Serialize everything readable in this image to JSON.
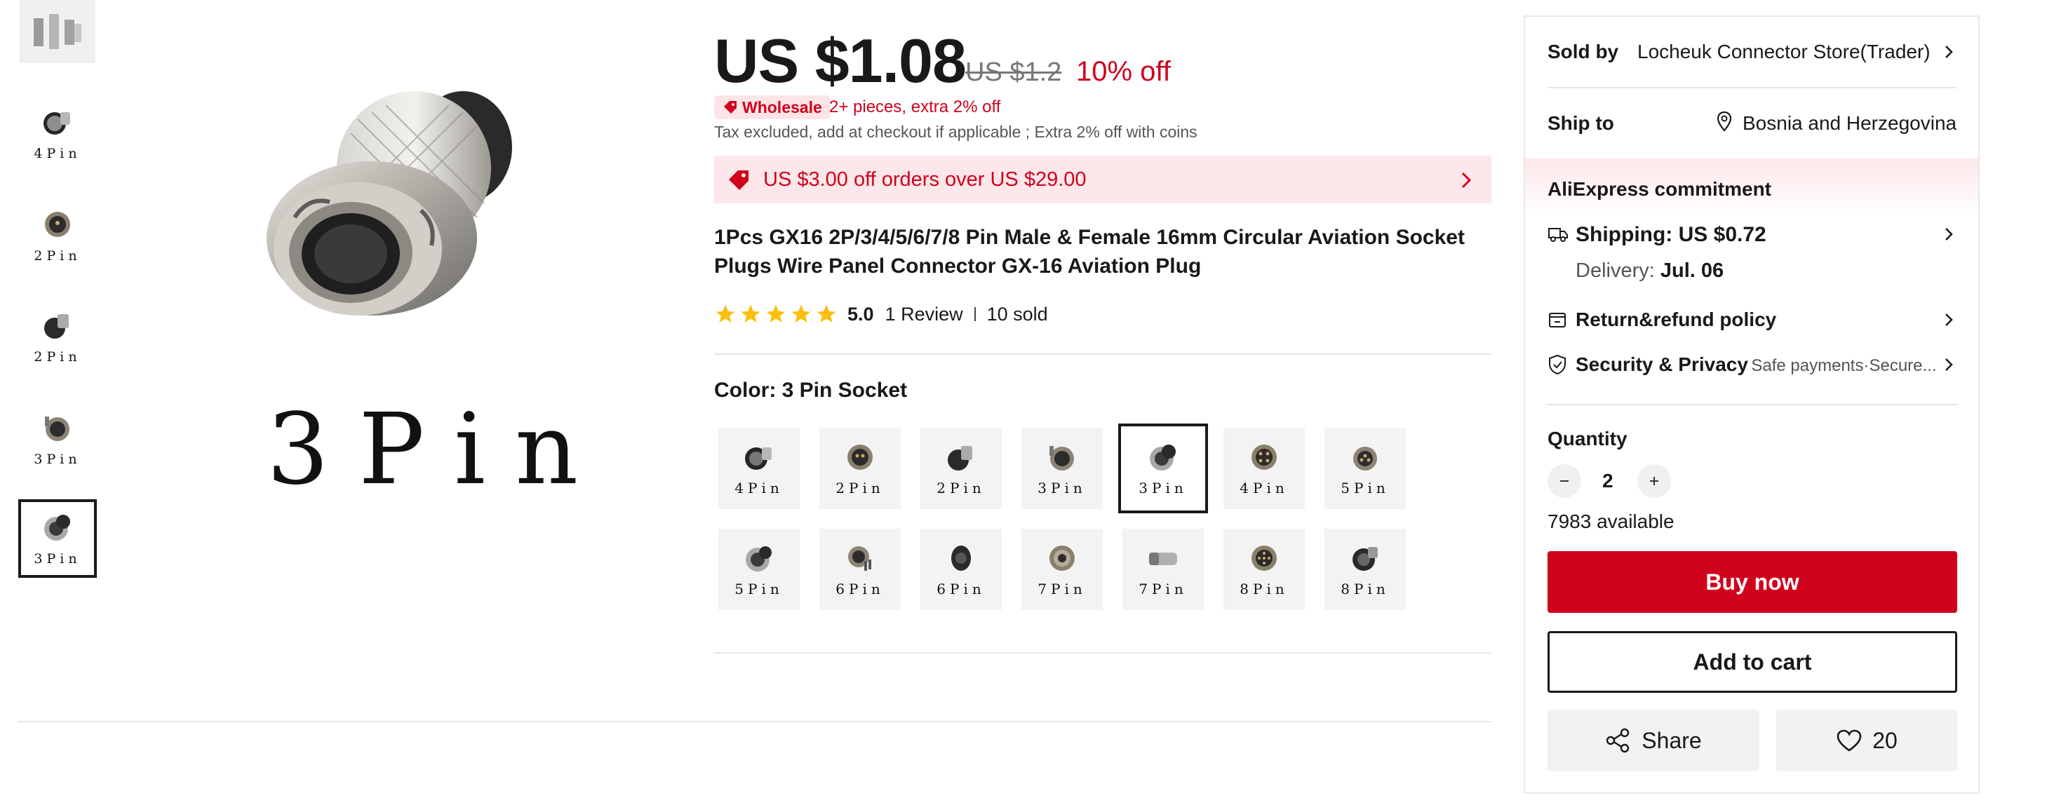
{
  "gallery": {
    "thumbnails": [
      {
        "caption": ""
      },
      {
        "caption": "4Pin"
      },
      {
        "caption": "2Pin"
      },
      {
        "caption": "2Pin"
      },
      {
        "caption": "3Pin"
      },
      {
        "caption": "3Pin"
      }
    ],
    "main_caption": "3Pin"
  },
  "price": {
    "current": "US $1.08",
    "original": "US $1.2",
    "discount": "10% off",
    "badge": "Wholesale",
    "wholesale_offer": "2+ pieces, extra 2% off",
    "tax_note": "Tax excluded, add at checkout if applicable ; Extra 2% off with coins"
  },
  "coupon": {
    "text": "US $3.00 off orders over US $29.00"
  },
  "product": {
    "title": "1Pcs GX16 2P/3/4/5/6/7/8 Pin Male & Female 16mm Circular Aviation Socket Plugs Wire Panel Connector GX-16 Aviation Plug",
    "rating": "5.0",
    "reviews": "1 Review",
    "sold": "10 sold"
  },
  "color": {
    "label": "Color: 3 Pin Socket",
    "options": [
      "4Pin",
      "2Pin",
      "2Pin",
      "3Pin",
      "3Pin",
      "4Pin",
      "5Pin",
      "5Pin",
      "6Pin",
      "6Pin",
      "7Pin",
      "7Pin",
      "8Pin",
      "8Pin"
    ],
    "selected_index": 4
  },
  "sidebar": {
    "sold_by_label": "Sold by",
    "store": "Locheuk Connector Store(Trader)",
    "ship_to_label": "Ship to",
    "ship_to": "Bosnia and Herzegovina",
    "commitment_title": "AliExpress commitment",
    "shipping": "Shipping: US $0.72",
    "delivery_label": "Delivery:",
    "delivery_date": "Jul. 06",
    "return_policy": "Return&refund policy",
    "security_title": "Security & Privacy",
    "security_detail": "Safe payments·Secure...",
    "quantity_label": "Quantity",
    "quantity": "2",
    "available": "7983 available",
    "buy_now": "Buy now",
    "add_to_cart": "Add to cart",
    "share": "Share",
    "wishlist_count": "20"
  },
  "colors": {
    "accent": "#d0021b",
    "coupon_bg": "#fde7ea",
    "star": "#fcbf0c"
  }
}
